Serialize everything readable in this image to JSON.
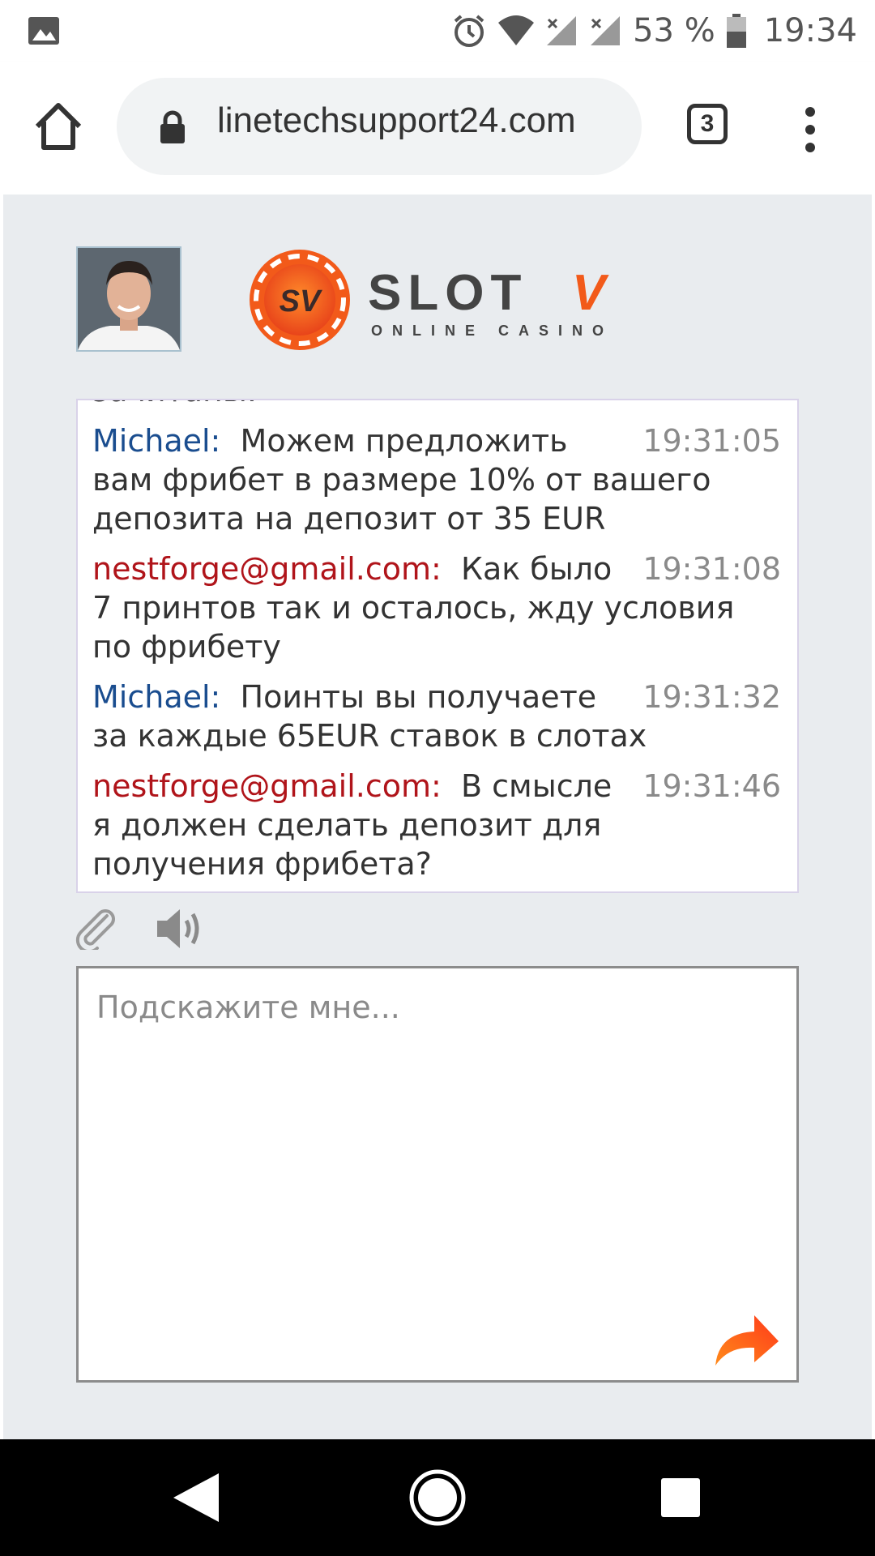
{
  "status_bar": {
    "battery_text": "53 %",
    "time": "19:34"
  },
  "browser": {
    "url": "linetechsupport24.com",
    "tab_count": "3"
  },
  "brand": {
    "logo_mark": "SV",
    "logo_name_main": "SLOT",
    "logo_name_accent": "V",
    "logo_tagline": "ONLINE CASINO"
  },
  "chat": {
    "partial_top": "зачитаны.",
    "messages": [
      {
        "author": "Michael:",
        "role": "agent",
        "text": "Можем предложить вам фрибет в размере 10% от вашего депозита на депозит от 35 EUR",
        "time": "19:31:05"
      },
      {
        "author": "nestforge@gmail.com:",
        "role": "user",
        "text": "Как было 7 принтов так и осталось, жду условия по фрибету",
        "time": "19:31:08"
      },
      {
        "author": "Michael:",
        "role": "agent",
        "text": "Поинты вы получаете за каждые 65EUR ставок в слотах",
        "time": "19:31:32"
      },
      {
        "author": "nestforge@gmail.com:",
        "role": "user",
        "text": "В смысле я должен сделать депозит для получения фрибета?",
        "time": "19:31:46"
      }
    ]
  },
  "input": {
    "placeholder": "Подскажите мне..."
  },
  "colors": {
    "agent": "#1a4d8f",
    "user": "#b0141a",
    "send_arrow": "#ff6a1a",
    "logo_orange": "#f25a1a"
  },
  "icons": {
    "home": "home-icon",
    "lock": "lock-icon",
    "menu": "more-vert-icon",
    "attach": "paperclip-icon",
    "sound": "speaker-icon",
    "send": "send-arrow-icon"
  }
}
